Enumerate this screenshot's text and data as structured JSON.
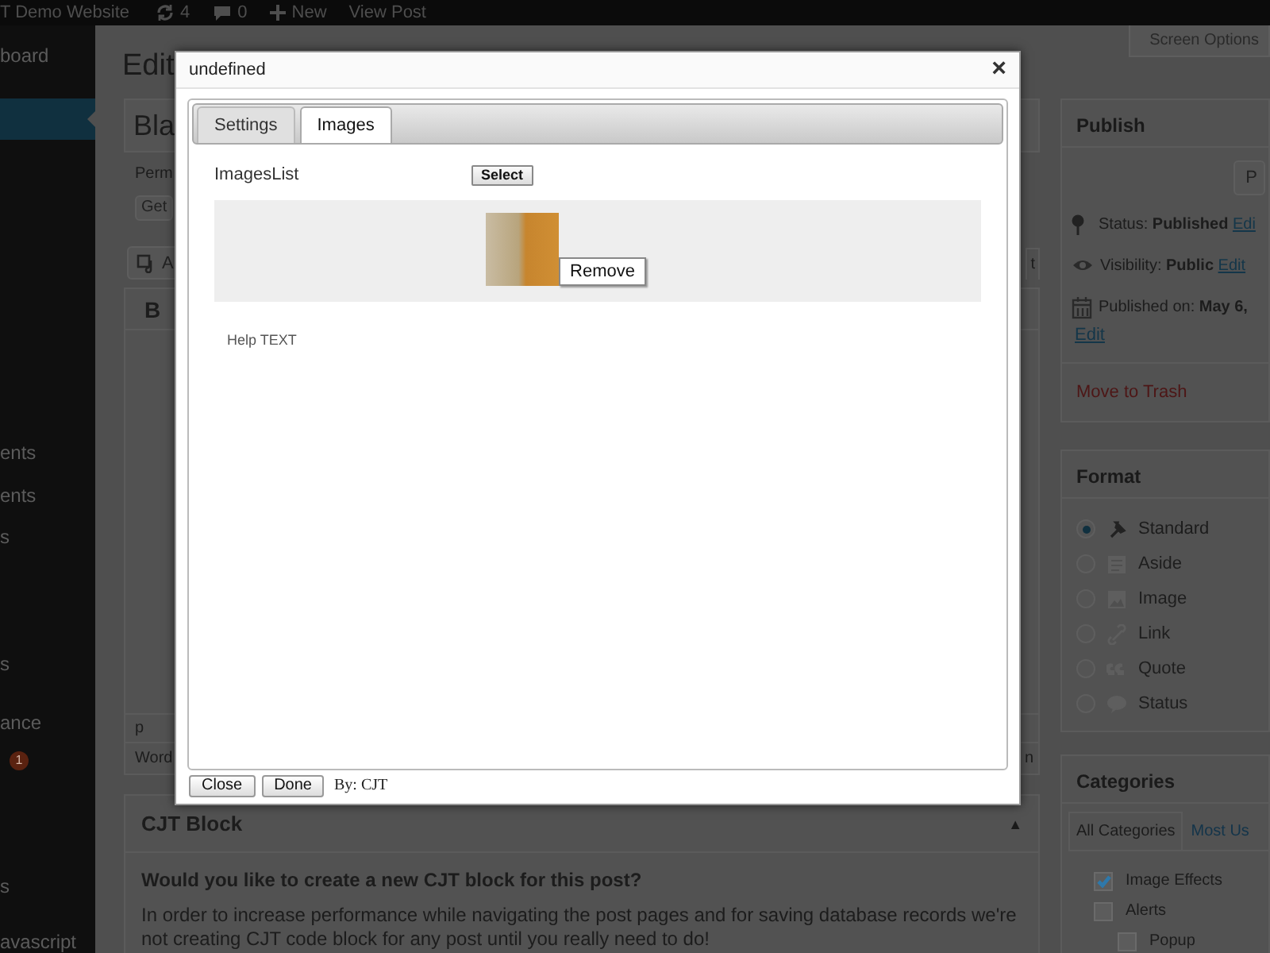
{
  "admin_bar": {
    "site": "T Demo Website",
    "updates": "4",
    "comments": "0",
    "new": "New",
    "view": "View Post"
  },
  "sidebar": {
    "items": [
      {
        "label": "board",
        "selected": false
      },
      {
        "selected": true
      },
      {
        "label": "ents",
        "selected": false
      },
      {
        "label": "ents",
        "selected": false
      },
      {
        "label": "s",
        "selected": false
      },
      {
        "label": "s",
        "selected": false
      },
      {
        "label": "ance",
        "selected": false
      },
      {
        "badge": "1",
        "selected": false
      },
      {
        "label": "s",
        "selected": false
      },
      {
        "label": "avascript",
        "selected": false
      }
    ]
  },
  "screen_options": "Screen Options",
  "editor": {
    "heading": "Edit",
    "title_value": "Bla",
    "permalink_label": "Perm",
    "permalink_button": "Get",
    "add_media": "A",
    "text_tab": "t",
    "toolbar_button": "B",
    "path": "p",
    "word_count": "Word",
    "word_count_edge": "n"
  },
  "cjt_block": {
    "title": "CJT Block",
    "toggle": "▲",
    "question": "Would you like to create a new CJT block for this post?",
    "text": "In order to increase performance while navigating the post pages and for saving database records we're not creating CJT code block for any post until you really need to do!"
  },
  "publish": {
    "title": "Publish",
    "preview_button": "P",
    "rows": [
      {
        "text": "Status: **Published**",
        "link": "Edi"
      },
      {
        "text": "Visibility: **Public**",
        "link": "Edit"
      },
      {
        "text": "Published on: **May 6,**"
      }
    ],
    "date_edit": "Edit",
    "trash": "Move to Trash"
  },
  "format": {
    "title": "Format",
    "options": [
      {
        "label": "Standard",
        "selected": true
      },
      {
        "label": "Aside",
        "selected": false
      },
      {
        "label": "Image",
        "selected": false
      },
      {
        "label": "Link",
        "selected": false
      },
      {
        "label": "Quote",
        "selected": false
      },
      {
        "label": "Status",
        "selected": false
      }
    ]
  },
  "categories": {
    "title": "Categories",
    "tabs": [
      {
        "label": "All Categories",
        "selected": true
      },
      {
        "label": "Most Us",
        "selected": false
      }
    ],
    "items": [
      {
        "label": "Image Effects",
        "checked": true
      },
      {
        "label": "Alerts",
        "checked": false,
        "children": [
          {
            "label": "Popup",
            "checked": false
          }
        ]
      }
    ]
  },
  "dialog": {
    "title": "undefined",
    "close": "×",
    "tabs": [
      {
        "label": "Settings",
        "selected": false
      },
      {
        "label": "Images",
        "selected": true
      }
    ],
    "field_label": "ImagesList",
    "select_button": "Select",
    "remove_button": "Remove",
    "help": "Help TEXT",
    "footer_buttons": [
      "Close",
      "Done"
    ],
    "credit_prefix": "By:",
    "credit_link": "CJT"
  }
}
